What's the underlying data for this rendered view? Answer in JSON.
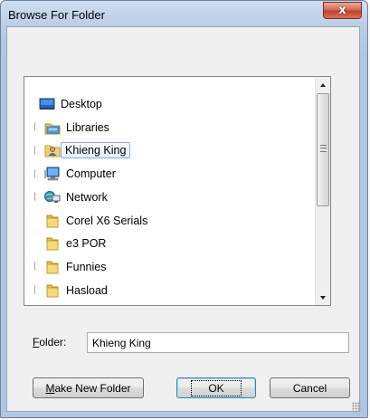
{
  "window": {
    "title": "Browse For Folder",
    "close_glyph": "x"
  },
  "tree": {
    "items": [
      {
        "label": "Desktop",
        "icon": "desktop-icon",
        "indent": 0,
        "expander": false,
        "selected": false
      },
      {
        "label": "Libraries",
        "icon": "libraries-icon",
        "indent": 1,
        "expander": true,
        "selected": false
      },
      {
        "label": "Khieng King",
        "icon": "user-folder-icon",
        "indent": 1,
        "expander": true,
        "selected": true
      },
      {
        "label": "Computer",
        "icon": "computer-icon",
        "indent": 1,
        "expander": true,
        "selected": false
      },
      {
        "label": "Network",
        "icon": "network-icon",
        "indent": 1,
        "expander": true,
        "selected": false
      },
      {
        "label": "Corel X6 Serials",
        "icon": "folder-icon",
        "indent": 1,
        "expander": false,
        "selected": false
      },
      {
        "label": "e3 POR",
        "icon": "folder-icon",
        "indent": 1,
        "expander": false,
        "selected": false
      },
      {
        "label": "Funnies",
        "icon": "folder-icon",
        "indent": 1,
        "expander": true,
        "selected": false
      },
      {
        "label": "Hasload",
        "icon": "folder-icon",
        "indent": 1,
        "expander": true,
        "selected": false
      }
    ]
  },
  "folder": {
    "label_prefix": "F",
    "label_rest": "older:",
    "value": "Khieng King"
  },
  "buttons": {
    "make_new_prefix": "M",
    "make_new_rest": "ake New Folder",
    "ok": "OK",
    "cancel": "Cancel"
  }
}
